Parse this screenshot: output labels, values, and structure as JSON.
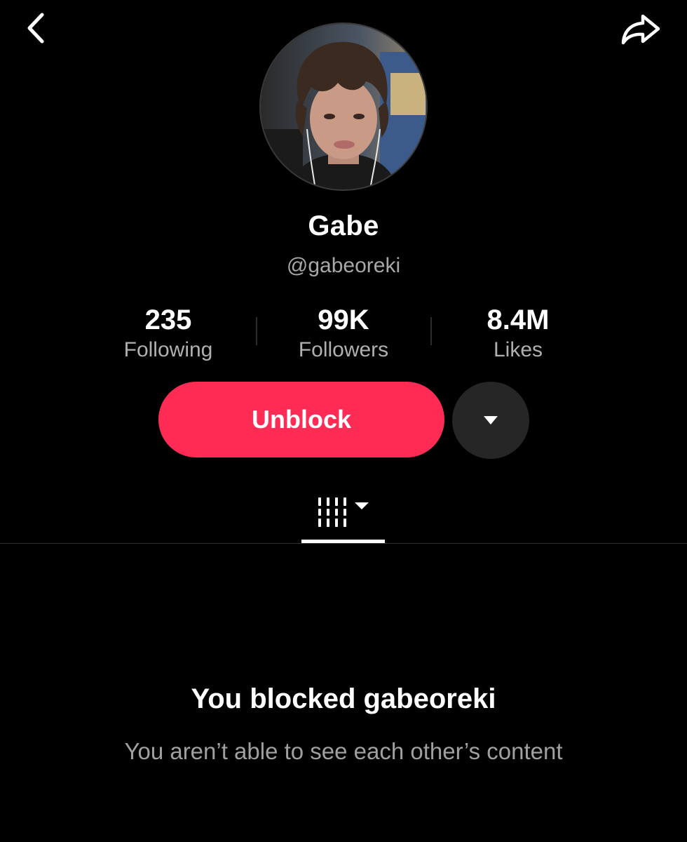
{
  "header": {
    "back_icon": "chevron-left-icon",
    "share_icon": "share-arrow-icon"
  },
  "profile": {
    "avatar_icon": "profile-photo",
    "display_name": "Gabe",
    "handle": "@gabeoreki"
  },
  "stats": [
    {
      "value": "235",
      "label": "Following"
    },
    {
      "value": "99K",
      "label": "Followers"
    },
    {
      "value": "8.4M",
      "label": "Likes"
    }
  ],
  "actions": {
    "unblock_label": "Unblock",
    "more_icon": "caret-down-icon",
    "accent_color": "#fe2c55"
  },
  "tabs": {
    "videos_icon": "grid-bars-icon",
    "videos_dropdown_icon": "caret-down-icon"
  },
  "blocked_notice": {
    "title": "You blocked gabeoreki",
    "subtitle": "You aren’t able to see each other’s content"
  }
}
